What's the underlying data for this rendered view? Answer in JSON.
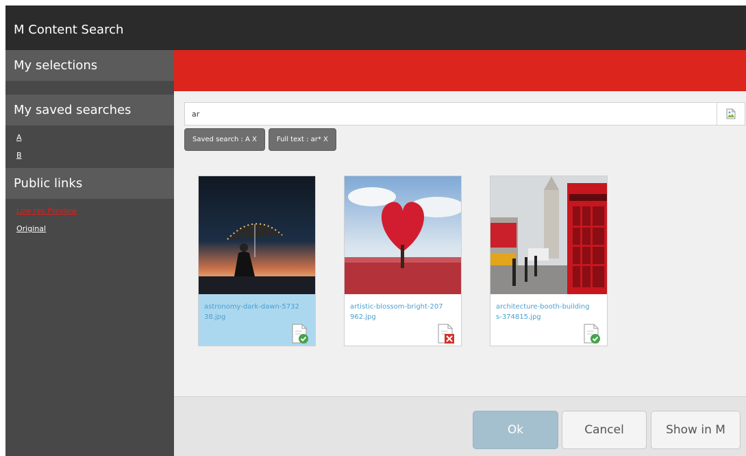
{
  "window": {
    "title": "M Content Search"
  },
  "sidebar": {
    "selections_heading": "My selections",
    "saved_heading": "My saved searches",
    "saved_items": [
      {
        "label": "A"
      },
      {
        "label": "B"
      }
    ],
    "public_heading": "Public links",
    "public_items": [
      {
        "label": "Low res Preview",
        "color": "#d8211c"
      },
      {
        "label": "Original",
        "color": "#ffffff"
      }
    ]
  },
  "header": {
    "accent_color": "#dc251d"
  },
  "search": {
    "value": "ar",
    "button_icon": "broken-image-icon",
    "chips": [
      {
        "label": "Saved search : A X"
      },
      {
        "label": "Full text : ar* X"
      }
    ]
  },
  "results": [
    {
      "filename": "astronomy-dark-dawn-573238.jpg",
      "selected": true,
      "status": "check-icon"
    },
    {
      "filename": "artistic-blossom-bright-207962.jpg",
      "selected": false,
      "status": "error-icon"
    },
    {
      "filename": "architecture-booth-buildings-374815.jpg",
      "selected": false,
      "status": "check-icon"
    }
  ],
  "footer": {
    "ok_label": "Ok",
    "cancel_label": "Cancel",
    "show_label": "Show in M"
  }
}
